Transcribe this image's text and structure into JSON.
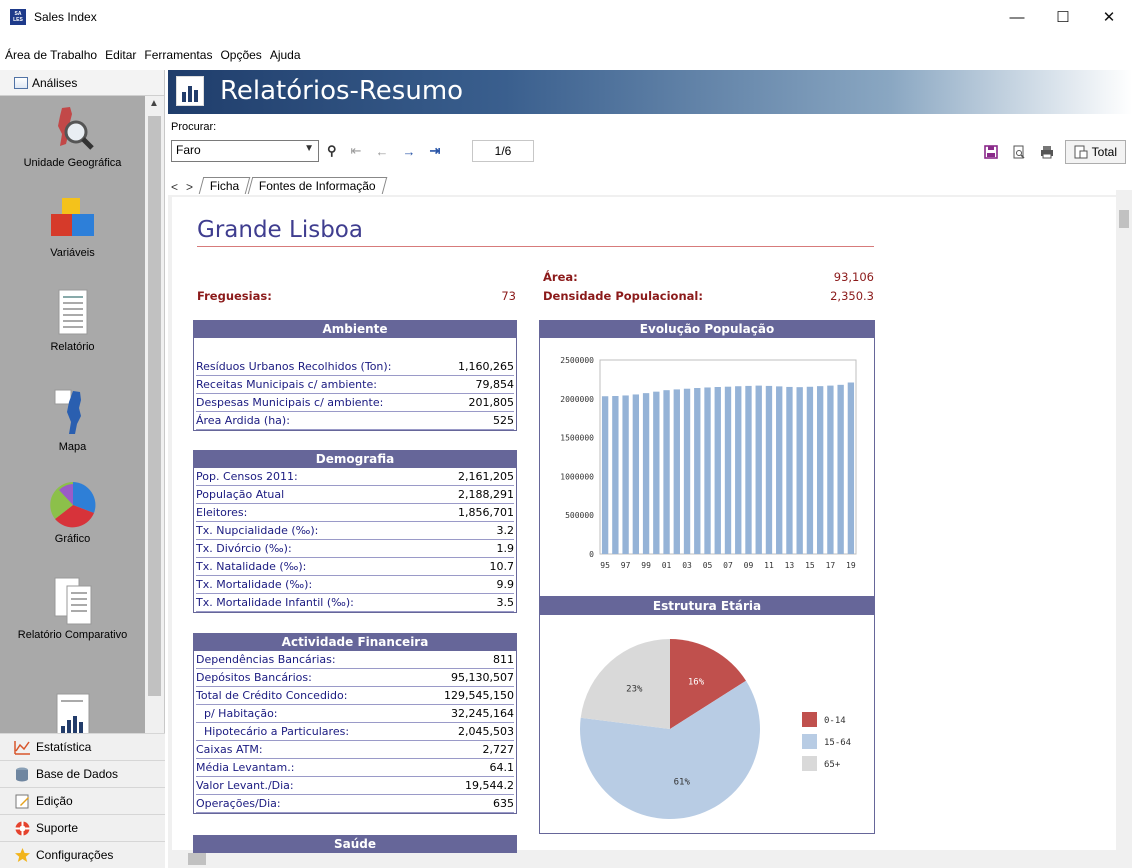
{
  "window": {
    "title": "Sales Index",
    "logo_text": "SALES INDEX",
    "minimize": "—",
    "maximize": "☐",
    "close": "✕"
  },
  "menu": [
    {
      "label": "Área de Trabalho"
    },
    {
      "label": "Editar"
    },
    {
      "label": "Ferramentas"
    },
    {
      "label": "Opções"
    },
    {
      "label": "Ajuda"
    }
  ],
  "sidebar": {
    "header": "Análises",
    "items": [
      {
        "label": "Unidade Geográfica",
        "icon": "portugal-map-magnifier-icon"
      },
      {
        "label": "Variáveis",
        "icon": "cubes-icon"
      },
      {
        "label": "Relatório",
        "icon": "report-icon"
      },
      {
        "label": "Mapa",
        "icon": "map-icon"
      },
      {
        "label": "Gráfico",
        "icon": "pie-chart-icon"
      },
      {
        "label": "Relatório Comparativo",
        "icon": "comparative-report-icon"
      },
      {
        "label": "",
        "icon": "chart-report-icon"
      }
    ],
    "sections": [
      {
        "label": "Estatística",
        "icon": "statistics-icon"
      },
      {
        "label": "Base de Dados",
        "icon": "database-icon"
      },
      {
        "label": "Edição",
        "icon": "edit-icon"
      },
      {
        "label": "Suporte",
        "icon": "lifebuoy-icon"
      },
      {
        "label": "Configurações",
        "icon": "star-icon"
      }
    ]
  },
  "banner": {
    "title": "Relatórios-Resumo"
  },
  "search": {
    "label": "Procurar:",
    "value": "Faro",
    "page": "1/6",
    "total_label": "Total"
  },
  "tabs": [
    "Ficha",
    "Fontes de Informação"
  ],
  "report": {
    "region": "Grande Lisboa",
    "freguesias_label": "Freguesias:",
    "freguesias_value": "73",
    "area_label": "Área:",
    "area_value": "93,106",
    "densidade_label": "Densidade Populacional:",
    "densidade_value": "2,350.3",
    "panels": [
      {
        "title": "Ambiente",
        "rows": [
          {
            "k": "Resíduos Urbanos Recolhidos (Ton):",
            "v": "1,160,265"
          },
          {
            "k": "Receitas Municipais c/ ambiente:",
            "v": "79,854"
          },
          {
            "k": "Despesas Municipais c/ ambiente:",
            "v": "201,805"
          },
          {
            "k": "Área Ardida (ha):",
            "v": "525"
          }
        ]
      },
      {
        "title": "Demografia",
        "rows": [
          {
            "k": "Pop. Censos 2011:",
            "v": "2,161,205"
          },
          {
            "k": "População Atual",
            "v": "2,188,291"
          },
          {
            "k": "Eleitores:",
            "v": "1,856,701"
          },
          {
            "k": "Tx. Nupcialidade (‰):",
            "v": "3.2"
          },
          {
            "k": "Tx. Divórcio (‰):",
            "v": "1.9"
          },
          {
            "k": "Tx. Natalidade (‰):",
            "v": "10.7"
          },
          {
            "k": "Tx. Mortalidade (‰):",
            "v": "9.9"
          },
          {
            "k": "Tx. Mortalidade Infantil (‰):",
            "v": "3.5"
          }
        ]
      },
      {
        "title": "Actividade Financeira",
        "rows": [
          {
            "k": "Dependências Bancárias:",
            "v": "811"
          },
          {
            "k": "Depósitos Bancários:",
            "v": "95,130,507"
          },
          {
            "k": "Total de Crédito Concedido:",
            "v": "129,545,150"
          },
          {
            "k": "p/ Habitação:",
            "v": "32,245,164",
            "indent": true
          },
          {
            "k": "Hipotecário a Particulares:",
            "v": "2,045,503",
            "indent": true
          },
          {
            "k": "Caixas ATM:",
            "v": "2,727"
          },
          {
            "k": "Média Levantam.:",
            "v": "64.1"
          },
          {
            "k": "Valor Levant./Dia:",
            "v": "19,544.2"
          },
          {
            "k": "Operações/Dia:",
            "v": "635"
          }
        ]
      },
      {
        "title": "Saúde",
        "rows": []
      }
    ]
  },
  "chart_data": [
    {
      "type": "bar",
      "title": "Evolução População",
      "color": "#95b3d7",
      "categories": [
        "95",
        "96",
        "97",
        "98",
        "99",
        "00",
        "01",
        "02",
        "03",
        "04",
        "05",
        "06",
        "07",
        "08",
        "09",
        "10",
        "11",
        "12",
        "13",
        "14",
        "15",
        "16",
        "17",
        "18",
        "19"
      ],
      "x_tick_labels": [
        "95",
        "97",
        "99",
        "01",
        "03",
        "05",
        "07",
        "09",
        "11",
        "13",
        "15",
        "17",
        "19"
      ],
      "values": [
        2033000,
        2036000,
        2043000,
        2056000,
        2073000,
        2092000,
        2111000,
        2121000,
        2130000,
        2139000,
        2146000,
        2152000,
        2156000,
        2162000,
        2166000,
        2170000,
        2166000,
        2160000,
        2153000,
        2150000,
        2155000,
        2163000,
        2170000,
        2180000,
        2210000
      ],
      "ylim": [
        0,
        2500000
      ],
      "y_ticks": [
        "0",
        "500000",
        "1000000",
        "1500000",
        "2000000",
        "2500000"
      ],
      "grid": false
    },
    {
      "type": "pie",
      "title": "Estrutura Etária",
      "slices": [
        {
          "label": "0-14",
          "value": 16,
          "text": "16%",
          "color": "#c0504d"
        },
        {
          "label": "15-64",
          "value": 61,
          "text": "61%",
          "color": "#b8cce4"
        },
        {
          "label": "65+",
          "value": 23,
          "text": "23%",
          "color": "#d9d9d9"
        }
      ],
      "legend_position": "right"
    }
  ]
}
